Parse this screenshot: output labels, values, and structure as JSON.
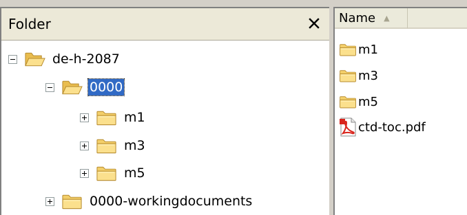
{
  "folder_pane": {
    "title": "Folder",
    "close_glyph": "✕",
    "tree": [
      {
        "label": "de-h-2087",
        "toggle": "minus",
        "icon": "folder-open-icon"
      },
      {
        "label": "0000",
        "toggle": "minus",
        "icon": "folder-open-icon",
        "selected": true
      },
      {
        "label": "m1",
        "toggle": "plus",
        "icon": "folder-icon"
      },
      {
        "label": "m3",
        "toggle": "plus",
        "icon": "folder-icon"
      },
      {
        "label": "m5",
        "toggle": "plus",
        "icon": "folder-icon"
      },
      {
        "label": "0000-workingdocuments",
        "toggle": "plus",
        "icon": "folder-icon"
      }
    ]
  },
  "file_pane": {
    "column_header": "Name",
    "sort_indicator": "▲",
    "files": [
      {
        "label": "m1",
        "icon": "folder-icon"
      },
      {
        "label": "m3",
        "icon": "folder-icon"
      },
      {
        "label": "m5",
        "icon": "folder-icon"
      },
      {
        "label": "ctd-toc.pdf",
        "icon": "pdf-file-icon"
      }
    ]
  },
  "colors": {
    "selection": "#316ac5",
    "folder_yellow": "#f6d36b",
    "pdf_red": "#d9251d"
  }
}
